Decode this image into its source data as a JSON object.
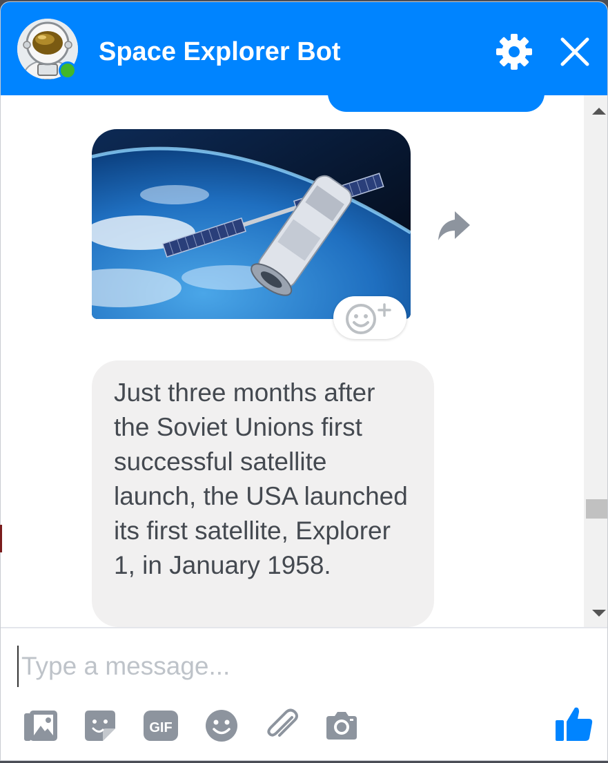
{
  "header": {
    "bot_name": "Space Explorer Bot",
    "status": "online",
    "accent_color": "#0084ff",
    "avatar_icon": "astronaut-avatar-icon",
    "actions": [
      "gear-icon",
      "close-icon"
    ]
  },
  "messages": {
    "image_message": {
      "icon": "satellite-orbit-image",
      "share_icon": "share-arrow-icon",
      "reaction_icon": "add-reaction-icon"
    },
    "text_message": "Just three months after the Soviet Unions first successful satellite launch, the USA launched its first satellite, Explorer 1, in January 1958."
  },
  "composer": {
    "placeholder": "Type a message...",
    "value": "",
    "tools": [
      {
        "name": "photo-icon"
      },
      {
        "name": "sticker-icon"
      },
      {
        "name": "gif-icon",
        "label": "GIF"
      },
      {
        "name": "emoji-icon"
      },
      {
        "name": "attachment-icon"
      },
      {
        "name": "camera-icon"
      }
    ],
    "like_icon": "thumbs-up-icon"
  }
}
